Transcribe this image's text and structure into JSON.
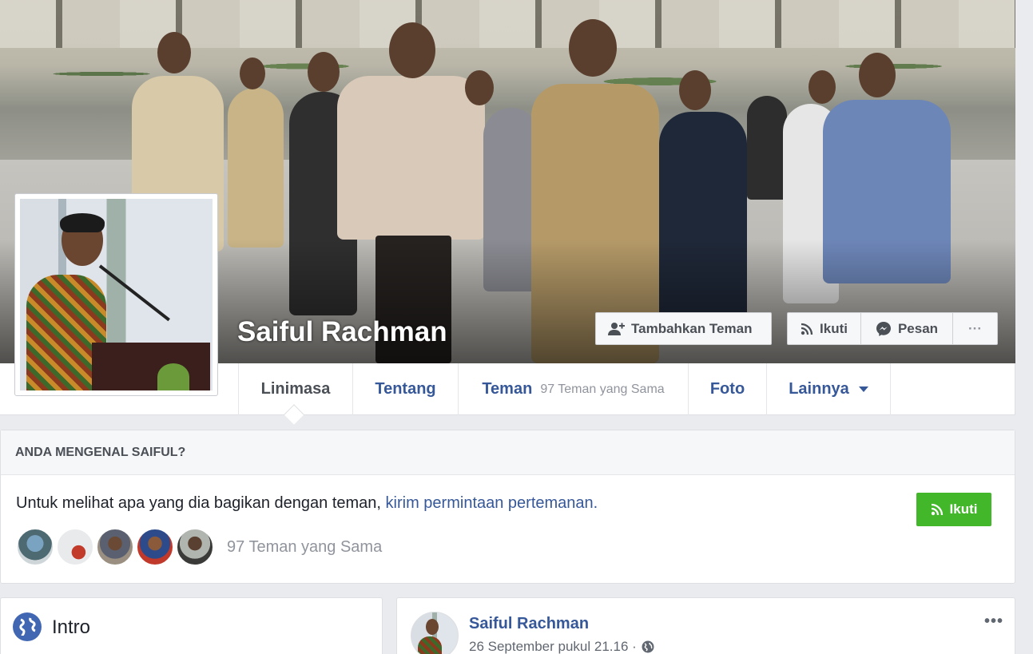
{
  "profile": {
    "name": "Saiful Rachman"
  },
  "actions": {
    "add_friend": "Tambahkan Teman",
    "follow": "Ikuti",
    "message": "Pesan",
    "more": "···"
  },
  "tabs": [
    {
      "label": "Linimasa",
      "sub": ""
    },
    {
      "label": "Tentang",
      "sub": ""
    },
    {
      "label": "Teman",
      "sub": "97 Teman yang Sama"
    },
    {
      "label": "Foto",
      "sub": ""
    },
    {
      "label": "Lainnya",
      "sub": ""
    }
  ],
  "know": {
    "heading": "ANDA MENGENAL SAIFUL?",
    "text": "Untuk melihat apa yang dia bagikan dengan teman, ",
    "link": "kirim permintaan pertemanan.",
    "follow": "Ikuti",
    "mutual_label": "97 Teman yang Sama"
  },
  "intro": {
    "title": "Intro"
  },
  "post": {
    "author": "Saiful Rachman",
    "date": "26 September pukul 21.16 ·",
    "more": "•••"
  },
  "colors": {
    "link_blue": "#365899",
    "green": "#42b72a",
    "page_bg": "#e9ebee"
  }
}
